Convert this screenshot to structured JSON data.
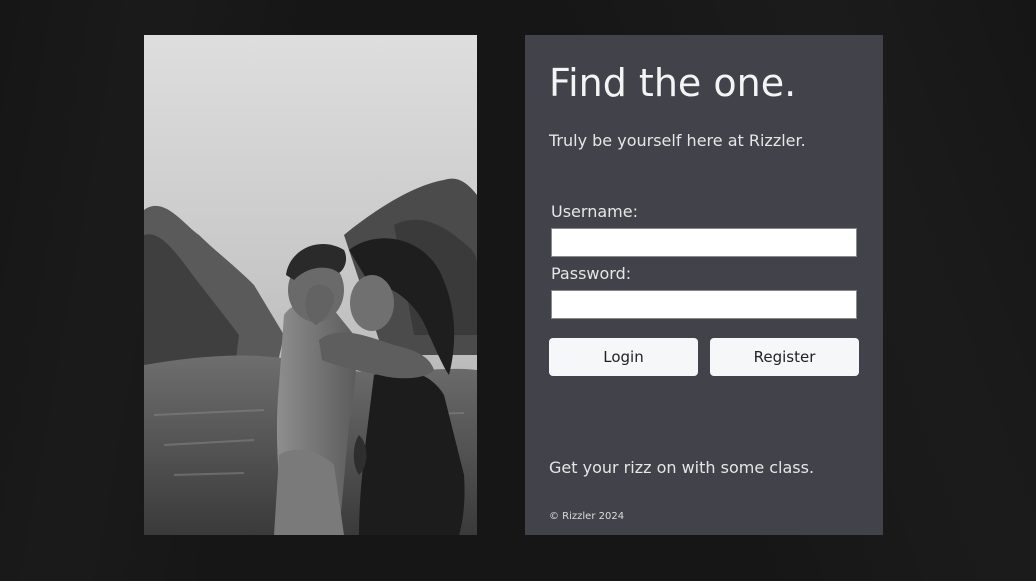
{
  "panel": {
    "headline": "Find the one.",
    "tagline": "Truly be yourself here at Rizzler.",
    "slogan": "Get your rizz on with some class.",
    "copyright": "© Rizzler 2024"
  },
  "form": {
    "username_label": "Username:",
    "username_value": "",
    "password_label": "Password:",
    "password_value": "",
    "login_label": "Login",
    "register_label": "Register"
  },
  "photo": {
    "description_icon": "couple-embracing-in-water-photo"
  },
  "colors": {
    "page_background": "#161616",
    "panel_background": "#42424a",
    "button_background": "#f6f7f9",
    "text_light": "#f2f2f2"
  }
}
